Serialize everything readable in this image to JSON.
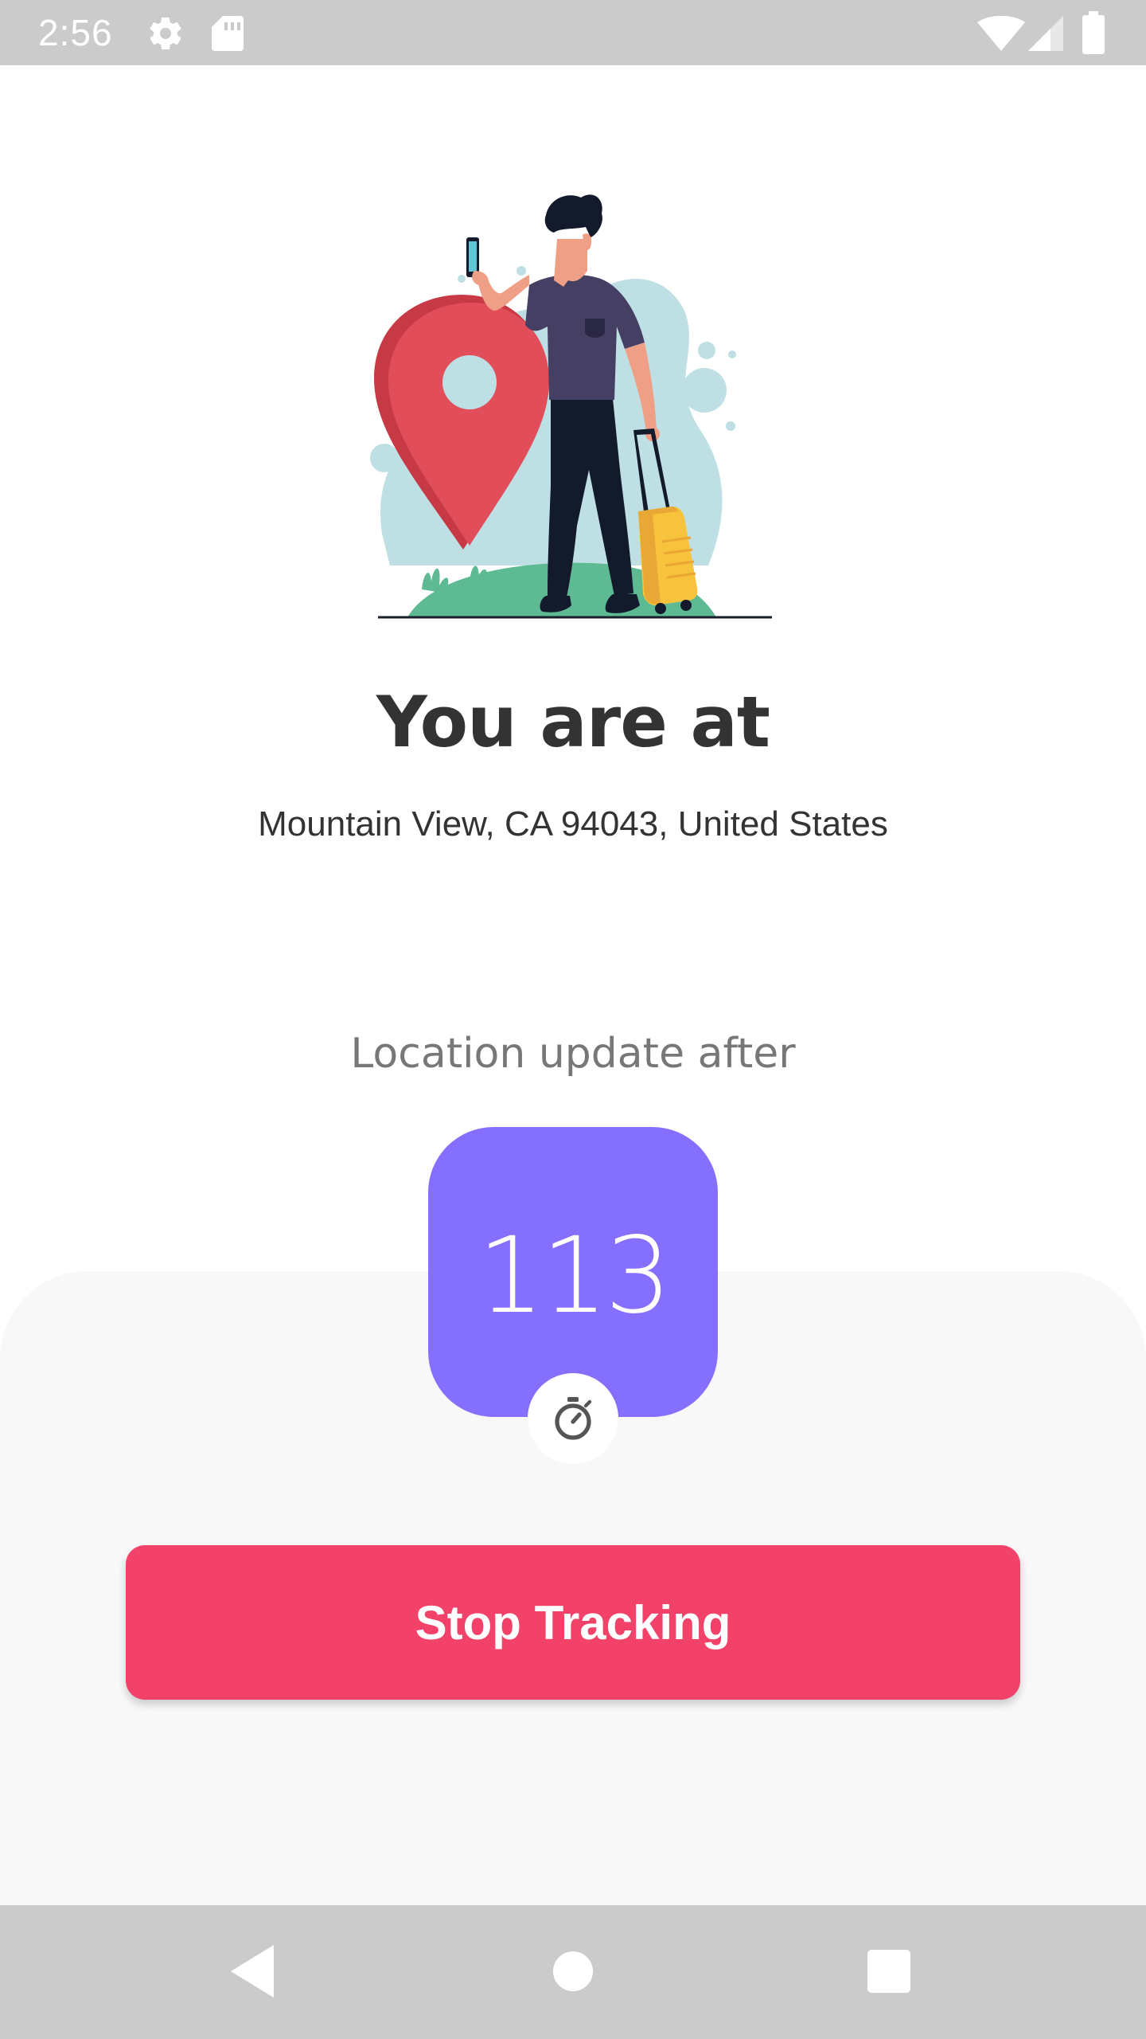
{
  "status_bar": {
    "time": "2:56",
    "icons": [
      "gear-icon",
      "sd-card-icon",
      "wifi-icon",
      "signal-icon",
      "battery-icon"
    ]
  },
  "main": {
    "title": "You are at",
    "address": "Mountain View, CA 94043, United States",
    "update_label": "Location update after",
    "countdown": "113",
    "timer_icon": "stopwatch-icon"
  },
  "actions": {
    "stop_label": "Stop Tracking"
  },
  "nav_bar": {
    "icons": [
      "back-icon",
      "home-icon",
      "recents-icon"
    ]
  },
  "colors": {
    "accent_purple": "#856ffe",
    "stop_button": "#f2426a",
    "status_bar": "#cccbcc",
    "panel": "#f8f8f8",
    "text_dark": "#333333",
    "text_grey": "#777777"
  }
}
